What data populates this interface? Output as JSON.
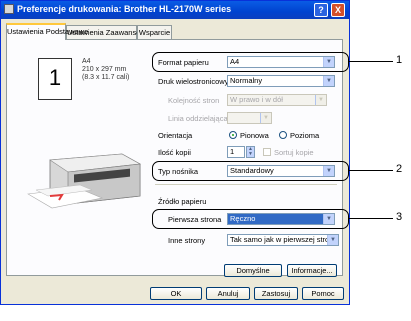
{
  "window": {
    "title": "Preferencje drukowania: Brother HL-2170W series",
    "help_glyph": "?",
    "close_glyph": "X"
  },
  "tabs": [
    {
      "label": "Ustawienia Podstawowe",
      "active": true
    },
    {
      "label": "Ustawienia Zaawansowane",
      "active": false
    },
    {
      "label": "Wsparcie",
      "active": false
    }
  ],
  "preview": {
    "page_number": "1",
    "size_name": "A4",
    "size_mm": "210 x 297 mm",
    "size_in": "(8.3 x 11.7 cali)"
  },
  "form": {
    "paper_size": {
      "label": "Format papieru",
      "value": "A4"
    },
    "media_type": {
      "label": "Druk wielostronicowy",
      "value": "Normalny"
    },
    "page_order": {
      "label": "Kolejność stron",
      "value": "W prawo i w dół"
    },
    "border_line": {
      "label": "Linia oddzielająca",
      "value": ""
    },
    "orientation": {
      "label": "Orientacja",
      "portrait": "Pionowa",
      "landscape": "Pozioma"
    },
    "copies": {
      "label": "Ilość kopii",
      "value": "1",
      "collate": "Sortuj kopie"
    },
    "media": {
      "label": "Typ nośnika",
      "value": "Standardowy"
    },
    "paper_source": {
      "heading": "Źródło papieru"
    },
    "first_page": {
      "label": "Pierwsza strona",
      "value": "Ręczno"
    },
    "other_pages": {
      "label": "Inne strony",
      "value": "Tak samo jak w pierwszej stronie"
    }
  },
  "buttons": {
    "default": "Domyślne",
    "about": "Informacje...",
    "ok": "OK",
    "cancel": "Anuluj",
    "apply": "Zastosuj",
    "help": "Pomoc"
  },
  "callouts": [
    "1",
    "2",
    "3"
  ]
}
